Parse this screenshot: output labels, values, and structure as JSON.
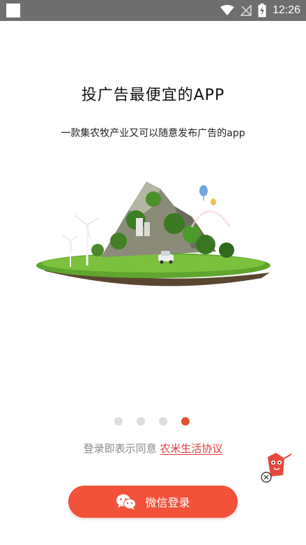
{
  "status_bar": {
    "time": "12:26"
  },
  "onboarding": {
    "title": "投广告最便宜的APP",
    "subtitle": "一款集农牧产业又可以随意发布广告的app",
    "page_count": 4,
    "active_page": 4
  },
  "agreement": {
    "prefix": "登录即表示同意",
    "link": "农米生活协议"
  },
  "login_button": {
    "label": "微信登录",
    "icon": "wechat-icon"
  },
  "colors": {
    "accent": "#F2513A",
    "link": "#E53935",
    "status_bar": "#6E6E6E"
  }
}
